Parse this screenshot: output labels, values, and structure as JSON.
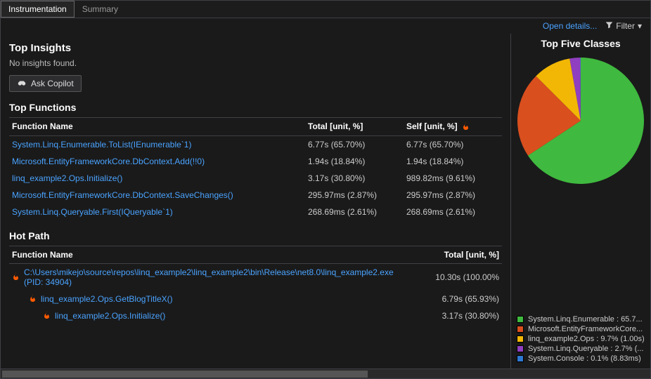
{
  "tabs": {
    "instrumentation": "Instrumentation",
    "summary": "Summary"
  },
  "toolbar": {
    "open_details": "Open details...",
    "filter": "Filter"
  },
  "insights": {
    "title": "Top Insights",
    "message": "No insights found.",
    "copilot_btn": "Ask Copilot"
  },
  "top_functions": {
    "title": "Top Functions",
    "col_name": "Function Name",
    "col_total": "Total [unit, %]",
    "col_self": "Self [unit, %]",
    "rows": [
      {
        "name": "System.Linq.Enumerable.ToList(IEnumerable`1)",
        "total": "6.77s (65.70%)",
        "self": "6.77s (65.70%)"
      },
      {
        "name": "Microsoft.EntityFrameworkCore.DbContext.Add(!!0)",
        "total": "1.94s (18.84%)",
        "self": "1.94s (18.84%)"
      },
      {
        "name": "linq_example2.Ops.Initialize()",
        "total": "3.17s (30.80%)",
        "self": "989.82ms (9.61%)"
      },
      {
        "name": "Microsoft.EntityFrameworkCore.DbContext.SaveChanges()",
        "total": "295.97ms (2.87%)",
        "self": "295.97ms (2.87%)"
      },
      {
        "name": "System.Linq.Queryable.First(IQueryable`1)",
        "total": "268.69ms (2.61%)",
        "self": "268.69ms (2.61%)"
      }
    ]
  },
  "hot_path": {
    "title": "Hot Path",
    "col_name": "Function Name",
    "col_total": "Total [unit, %]",
    "rows": [
      {
        "indent": 0,
        "name": "C:\\Users\\mikejo\\source\\repos\\linq_example2\\linq_example2\\bin\\Release\\net8.0\\linq_example2.exe (PID: 34904)",
        "total": "10.30s (100.00%"
      },
      {
        "indent": 1,
        "name": "linq_example2.Ops.GetBlogTitleX()",
        "total": "6.79s (65.93%)"
      },
      {
        "indent": 2,
        "name": "linq_example2.Ops.Initialize()",
        "total": "3.17s (30.80%)"
      }
    ]
  },
  "chart": {
    "title": "Top Five Classes",
    "legend": [
      {
        "color": "#3fb93f",
        "label": "System.Linq.Enumerable : 65.7..."
      },
      {
        "color": "#d94f1e",
        "label": "Microsoft.EntityFrameworkCore..."
      },
      {
        "color": "#f2b705",
        "label": "linq_example2.Ops : 9.7% (1.00s)"
      },
      {
        "color": "#8f3fbf",
        "label": "System.Linq.Queryable : 2.7% (..."
      },
      {
        "color": "#2e78d2",
        "label": "System.Console : 0.1% (8.83ms)"
      }
    ]
  },
  "chart_data": {
    "type": "pie",
    "title": "Top Five Classes",
    "series": [
      {
        "name": "System.Linq.Enumerable",
        "value": 65.7,
        "color": "#3fb93f"
      },
      {
        "name": "Microsoft.EntityFrameworkCore",
        "value": 21.8,
        "color": "#d94f1e"
      },
      {
        "name": "linq_example2.Ops",
        "value": 9.7,
        "color": "#f2b705"
      },
      {
        "name": "System.Linq.Queryable",
        "value": 2.7,
        "color": "#8f3fbf"
      },
      {
        "name": "System.Console",
        "value": 0.1,
        "color": "#2e78d2"
      }
    ]
  }
}
